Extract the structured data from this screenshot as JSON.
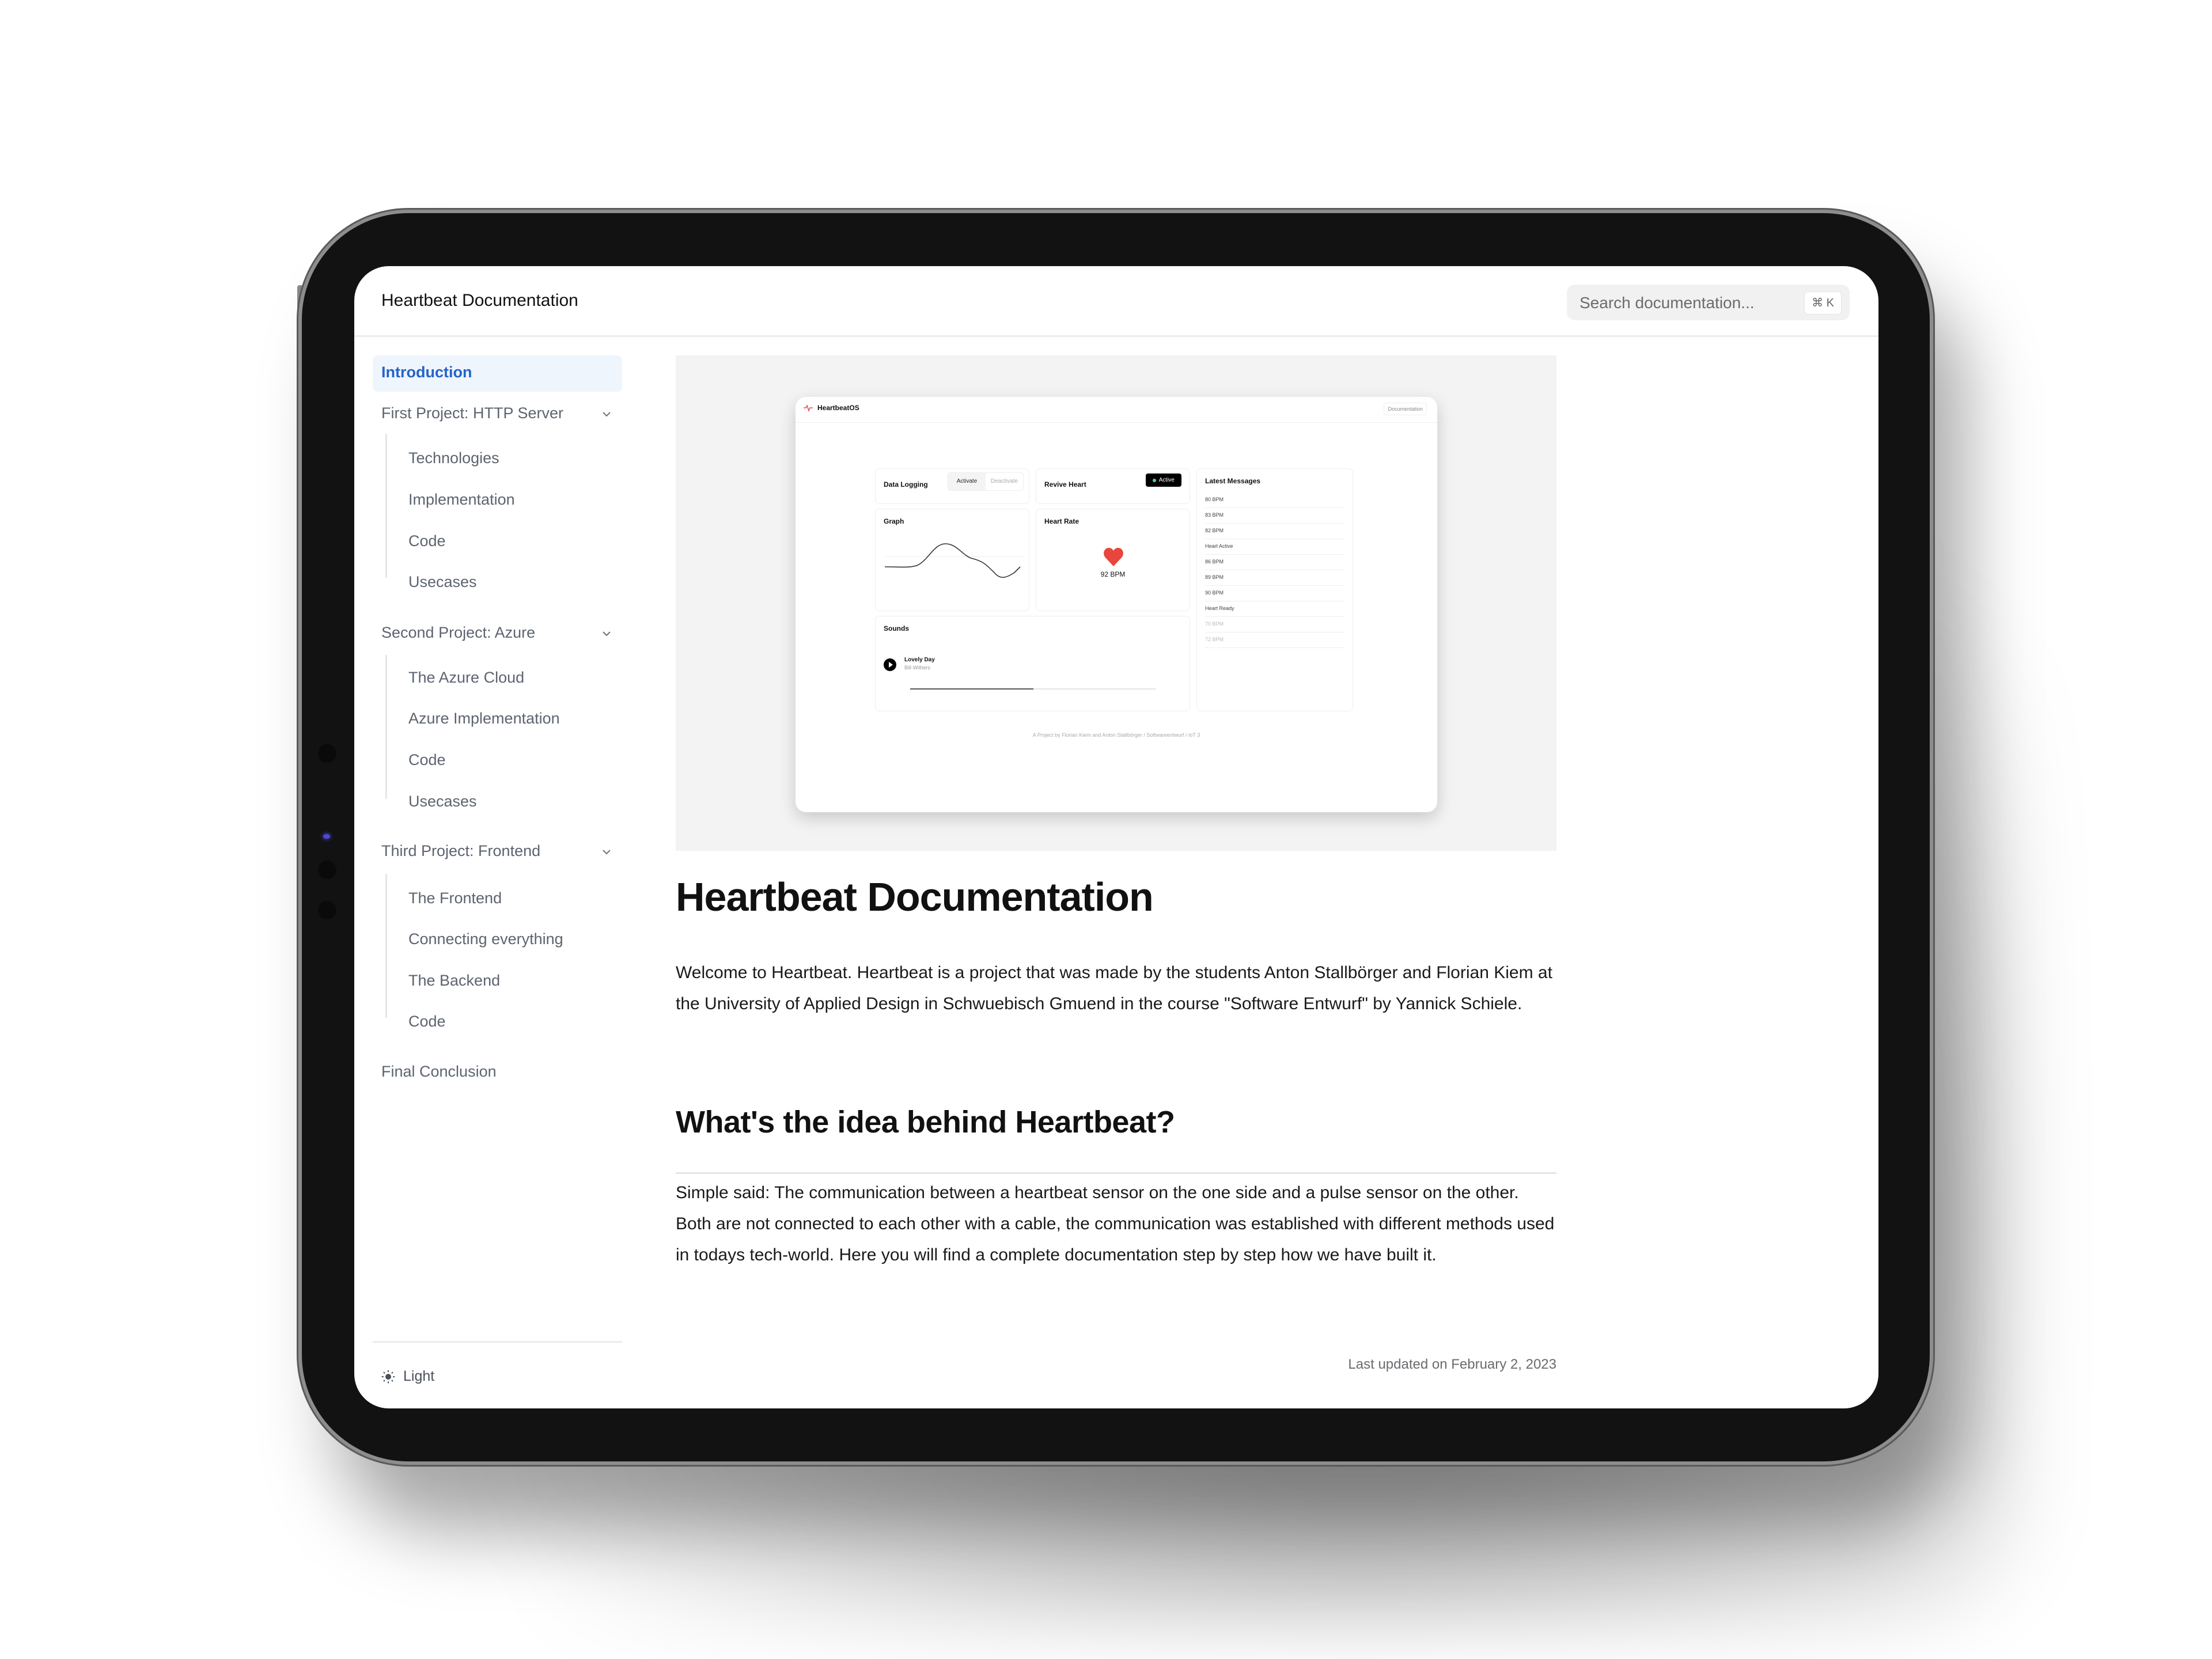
{
  "header": {
    "title": "Heartbeat Documentation",
    "search_placeholder": "Search documentation...",
    "search_shortcut": "⌘ K"
  },
  "sidebar": {
    "items": [
      {
        "label": "Introduction",
        "active": true
      },
      {
        "label": "First Project: HTTP Server",
        "expandable": true,
        "children": [
          "Technologies",
          "Implementation",
          "Code",
          "Usecases"
        ]
      },
      {
        "label": "Second Project: Azure",
        "expandable": true,
        "children": [
          "The Azure Cloud",
          "Azure Implementation",
          "Code",
          "Usecases"
        ]
      },
      {
        "label": "Third Project: Frontend",
        "expandable": true,
        "children": [
          "The Frontend",
          "Connecting everything",
          "The Backend",
          "Code"
        ]
      },
      {
        "label": "Final Conclusion"
      }
    ],
    "theme_label": "Light"
  },
  "hero_mock": {
    "app_name": "HeartbeatOS",
    "docs_link": "Documentation",
    "data_logging": {
      "title": "Data Logging",
      "activate": "Activate",
      "deactivate": "Deactivate"
    },
    "revive": {
      "title": "Revive Heart",
      "status": "Active"
    },
    "graph": {
      "title": "Graph"
    },
    "heart_rate": {
      "title": "Heart Rate",
      "value": "92 BPM"
    },
    "sounds": {
      "title": "Sounds",
      "song": "Lovely Day",
      "artist": "Bill Withers",
      "progress": 0.5
    },
    "messages": {
      "title": "Latest Messages",
      "items": [
        "80 BPM",
        "83 BPM",
        "82 BPM",
        "Heart Active",
        "86 BPM",
        "89 BPM",
        "90 BPM",
        "Heart Ready",
        "70 BPM",
        "72 BPM"
      ]
    },
    "footer": "A Project by Florian Kiem and Anton Stallbörger / Softwareentwurf / IoT 3"
  },
  "content": {
    "h1": "Heartbeat Documentation",
    "intro": "Welcome to Heartbeat. Heartbeat is a project that was made by the students Anton Stallbörger and Florian Kiem at the University of Applied Design in Schwuebisch Gmuend in the course \"Software Entwurf\" by Yannick Schiele.",
    "h2": "What's the idea behind Heartbeat?",
    "idea": "Simple said: The communication between a heartbeat sensor on the one side and a pulse sensor on the other. Both are not connected to each other with a cable, the communication was established with different methods used in todays tech-world. Here you will find a complete documentation step by step how we have built it.",
    "last_updated": "Last updated on February 2, 2023"
  },
  "colors": {
    "accent": "#2563c9",
    "active_bg": "#eef5fd",
    "heart": "#e8453c"
  }
}
